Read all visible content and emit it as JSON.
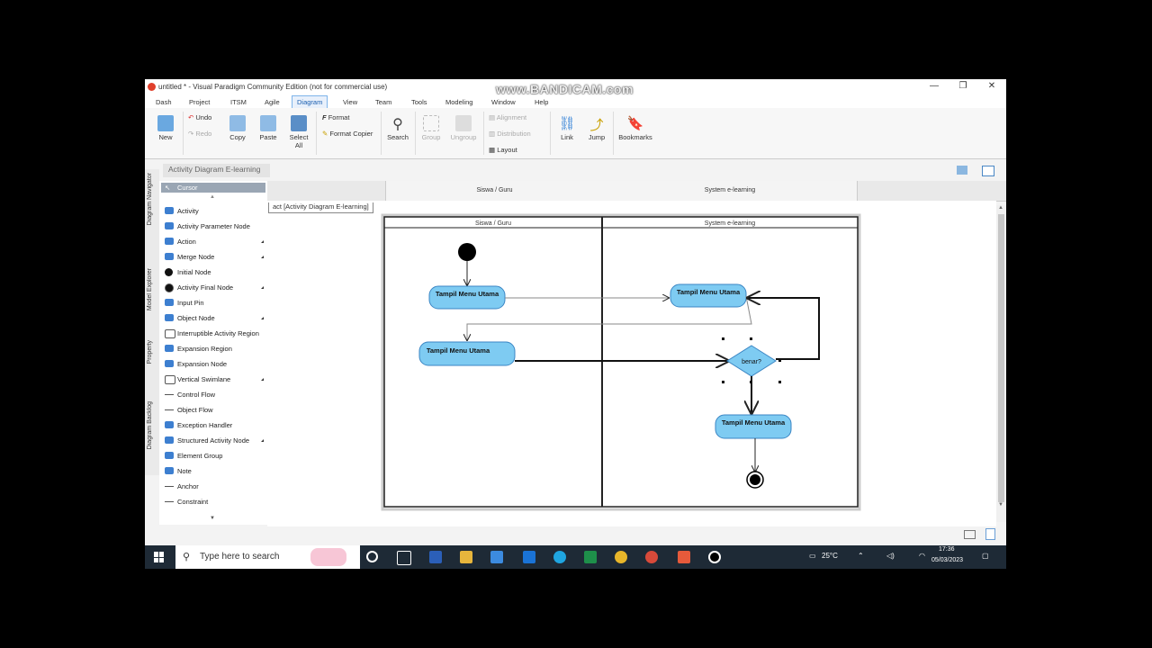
{
  "window": {
    "title": "untitled * - Visual Paradigm Community Edition (not for commercial use)",
    "watermark": "www.BANDICAM.com",
    "controls": {
      "minimize": "—",
      "restore": "❐",
      "close": "✕"
    }
  },
  "menu": [
    "Dash",
    "Project",
    "ITSM",
    "Agile",
    "Diagram",
    "View",
    "Team",
    "Tools",
    "Modeling",
    "Window",
    "Help"
  ],
  "menu_active": "Diagram",
  "ribbon": {
    "new": "New",
    "undo": "Undo",
    "redo": "Redo",
    "copy": "Copy",
    "paste": "Paste",
    "select_all_1": "Select",
    "select_all_2": "All",
    "format": "Format",
    "format_copier": "Format Copier",
    "search": "Search",
    "group": "Group",
    "ungroup": "Ungroup",
    "alignment": "Alignment",
    "distribution": "Distribution",
    "layout": "Layout",
    "link": "Link",
    "jump": "Jump",
    "bookmarks": "Bookmarks"
  },
  "breadcrumb": "Activity Diagram E-learning",
  "side_tabs": [
    "Diagram Navigator",
    "Model Explorer",
    "Property",
    "Diagram Backlog"
  ],
  "palette": {
    "cursor": "Cursor",
    "items": [
      "Activity",
      "Activity Parameter Node",
      "Action",
      "Merge Node",
      "Initial Node",
      "Activity Final Node",
      "Input Pin",
      "Object Node",
      "Interruptible Activity Region",
      "Expansion Region",
      "Expansion Node",
      "Vertical Swimlane",
      "Control Flow",
      "Object Flow",
      "Exception Handler",
      "Structured Activity Node",
      "Element Group",
      "Note",
      "Anchor",
      "Constraint"
    ]
  },
  "lane_headers": [
    "Siswa / Guru",
    "System e-learning"
  ],
  "frame_label": "act [Activity Diagram E-learning]",
  "diagram": {
    "lanes": [
      "Siswa / Guru",
      "System e-learning"
    ],
    "actions": [
      "Tampil Menu Utama",
      "Tampil Menu Utama",
      "Tampil Menu Utama",
      "Tampil Menu Utama"
    ],
    "decision": "benar?"
  },
  "colors": {
    "action_fill": "#7ecbf2",
    "action_stroke": "#3b86c4",
    "taskbar": "#1e2a36",
    "accent": "#1b5fb0"
  },
  "taskbar": {
    "search_placeholder": "Type here to search",
    "weather": "25°C",
    "time": "17:36",
    "date": "05/03/2023"
  }
}
